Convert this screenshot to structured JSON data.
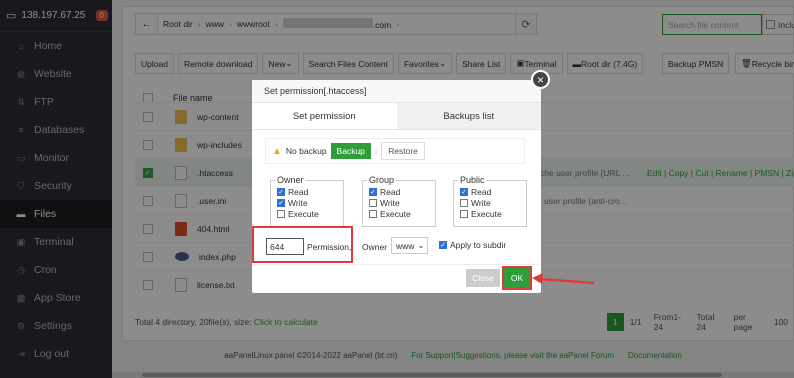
{
  "sidebar": {
    "server_ip": "138.197.67.25",
    "badge": "0",
    "items": [
      {
        "label": "Home",
        "icon": "home-icon"
      },
      {
        "label": "Website",
        "icon": "globe-icon"
      },
      {
        "label": "FTP",
        "icon": "ftp-icon"
      },
      {
        "label": "Databases",
        "icon": "database-icon"
      },
      {
        "label": "Monitor",
        "icon": "monitor-icon"
      },
      {
        "label": "Security",
        "icon": "shield-icon"
      },
      {
        "label": "Files",
        "icon": "folder-icon"
      },
      {
        "label": "Terminal",
        "icon": "terminal-icon"
      },
      {
        "label": "Cron",
        "icon": "clock-icon"
      },
      {
        "label": "App Store",
        "icon": "grid-icon"
      },
      {
        "label": "Settings",
        "icon": "gear-icon"
      },
      {
        "label": "Log out",
        "icon": "logout-icon"
      }
    ]
  },
  "path": {
    "root": "Root dir",
    "p1": "www",
    "p2": "wwwroot",
    "p3_suffix": ".com"
  },
  "search": {
    "placeholder": "Search file content",
    "include_label": "Inclu"
  },
  "toolbar": {
    "upload": "Upload",
    "remote": "Remote download",
    "new": "New",
    "search_files": "Search Files Content",
    "favorites": "Favorites",
    "share": "Share List",
    "terminal": "Terminal",
    "root_dir": "Root dir (7.4G)",
    "backup": "Backup PMSN",
    "recycle": "Recycle bin"
  },
  "table": {
    "col_name": "File name",
    "rows": [
      {
        "name": "wp-content",
        "type": "folder",
        "extra": ""
      },
      {
        "name": "wp-includes",
        "type": "folder",
        "extra": ""
      },
      {
        "name": ".htaccess",
        "type": "file",
        "extra": "che user profile (URL ...",
        "actions": "Edit | Copy | Cut | Rename | PMSN | Zip | D"
      },
      {
        "name": ".user.ini",
        "type": "file",
        "extra": "' user profile (anti-cro..."
      },
      {
        "name": "404.html",
        "type": "html",
        "extra": ""
      },
      {
        "name": "index.php",
        "type": "php",
        "extra": ""
      },
      {
        "name": "license.txt",
        "type": "file",
        "extra": ""
      }
    ]
  },
  "summary": {
    "text": "Total 4 directory, 20file(s), size:",
    "link": "Click to calculate"
  },
  "pager": {
    "current": "1",
    "pages": "1/1",
    "range": "From1-24",
    "total": "Total 24",
    "per_page": "per page",
    "per_val": "100"
  },
  "footer": {
    "copyright": "aaPanelLinux panel ©2014-2022 aaPanel (bt.cn)",
    "support": "For Support|Suggestions, please visit the aaPanel Forum",
    "docs": "Documentation"
  },
  "modal": {
    "title": "Set permission[.htaccess]",
    "close": "×",
    "tab1": "Set permission",
    "tab2": "Backups list",
    "no_backup": "No backup",
    "backup_btn": "Backup",
    "restore_btn": "Restore",
    "owner_group": "Owner",
    "group_group": "Group",
    "public_group": "Public",
    "read": "Read",
    "write": "Write",
    "execute": "Execute",
    "owner_perms": {
      "read": true,
      "write": true,
      "execute": false
    },
    "group_perms": {
      "read": true,
      "write": false,
      "execute": false
    },
    "public_perms": {
      "read": true,
      "write": false,
      "execute": false
    },
    "perm_value": "644",
    "perm_label": "Permission,",
    "owner_label": "Owner",
    "owner_value": "www",
    "apply_label": "Apply to subdir",
    "close_btn": "Close",
    "ok_btn": "OK"
  },
  "colors": {
    "accent": "#2e9e3b",
    "highlight": "#e03a3a"
  }
}
